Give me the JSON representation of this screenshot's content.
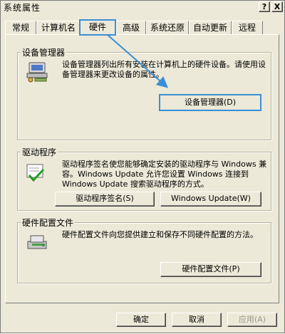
{
  "window": {
    "title": "系统属性",
    "help_btn": "?",
    "close_btn": "X"
  },
  "tabs": [
    {
      "label": "常规"
    },
    {
      "label": "计算机名"
    },
    {
      "label": "硬件"
    },
    {
      "label": "高级"
    },
    {
      "label": "系统还原"
    },
    {
      "label": "自动更新"
    },
    {
      "label": "远程"
    }
  ],
  "device_manager": {
    "title": "设备管理器",
    "description": "设备管理器列出所有安装在计算机上的硬件设备。请使用设备管理器来更改设备的属性。",
    "button": "设备管理器(D)"
  },
  "drivers": {
    "title": "驱动程序",
    "description": "驱动程序签名使您能够确定安装的驱动程序与 Windows 兼容。Windows Update 允许您设置 Windows 连接到 Windows Update 搜索驱动程序的方式。",
    "signing_button": "驱动程序签名(S)",
    "update_button": "Windows Update(W)"
  },
  "hw_profiles": {
    "title": "硬件配置文件",
    "description": "硬件配置文件向您提供建立和保存不同硬件配置的方法。",
    "button": "硬件配置文件(P)"
  },
  "footer": {
    "ok": "确定",
    "cancel": "取消",
    "apply": "应用(A)"
  },
  "colors": {
    "highlight": "#3a8fd6",
    "face": "#ece9d8"
  }
}
